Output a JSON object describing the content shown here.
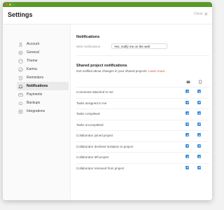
{
  "window": {
    "title": "Settings",
    "close_label": "Close"
  },
  "colors": {
    "accent": "#3b8fe0",
    "titlebar": "#5a9a28",
    "link": "#dd4b39"
  },
  "sidebar": {
    "items": [
      {
        "label": "Account",
        "icon": "user-icon"
      },
      {
        "label": "General",
        "icon": "gear-icon"
      },
      {
        "label": "Theme",
        "icon": "palette-icon"
      },
      {
        "label": "Karma",
        "icon": "karma-icon"
      },
      {
        "label": "Reminders",
        "icon": "alarm-clock-icon"
      },
      {
        "label": "Notifications",
        "icon": "bell-icon",
        "active": true
      },
      {
        "label": "Payments",
        "icon": "credit-card-icon"
      },
      {
        "label": "Backups",
        "icon": "cloud-icon"
      },
      {
        "label": "Integrations",
        "icon": "puzzle-icon"
      }
    ]
  },
  "notifications": {
    "title": "Notifications",
    "web_label": "Web notifications",
    "web_value": "Yes, notify me on the web"
  },
  "shared": {
    "title": "Shared project notifications",
    "subtitle": "Get notified about changes in your shared projects.",
    "learn_more": "Learn more...",
    "columns": [
      {
        "icon": "email-icon"
      },
      {
        "icon": "mobile-icon"
      }
    ],
    "rows": [
      {
        "label": "Comments attached to me",
        "email": true,
        "push": true
      },
      {
        "label": "Tasks assigned to me",
        "email": true,
        "push": true
      },
      {
        "label": "Tasks completed",
        "email": true,
        "push": true
      },
      {
        "label": "Tasks uncompleted",
        "email": true,
        "push": true
      },
      {
        "label": "Collaborator joined project",
        "email": true,
        "push": true
      },
      {
        "label": "Collaborator declined invitation to project",
        "email": true,
        "push": true
      },
      {
        "label": "Collaborator left project",
        "email": true,
        "push": true
      },
      {
        "label": "Collaborator removed from project",
        "email": true,
        "push": true
      }
    ]
  }
}
